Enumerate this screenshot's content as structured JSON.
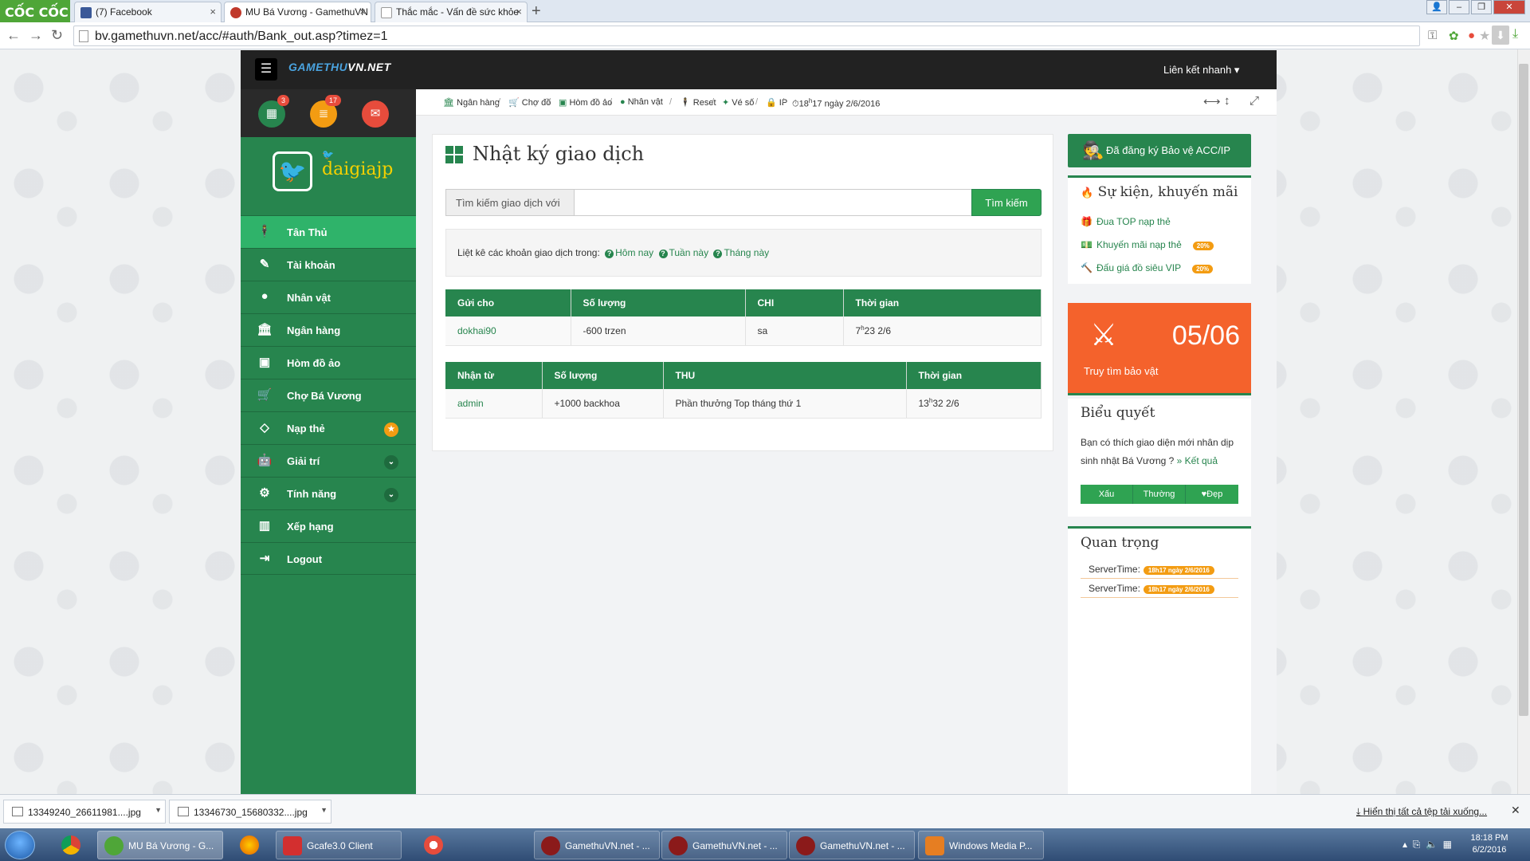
{
  "browser": {
    "brand": "CỐC CỐC",
    "tabs": [
      {
        "title": "(7) Facebook"
      },
      {
        "title": "MU Bá Vương - GamethuVN"
      },
      {
        "title": "Thắc mắc - Vấn đề sức khỏe"
      }
    ],
    "url": "bv.gamethuvn.net/acc/#auth/Bank_out.asp?timez=1"
  },
  "header": {
    "logo_prefix": "GAMETHU",
    "logo_suffix": "VN.NET",
    "quick_link": "Liên kết nhanh"
  },
  "top_icons": [
    {
      "icon": "calendar-icon",
      "badge": "3",
      "color": "#27854e"
    },
    {
      "icon": "list-icon",
      "badge": "17",
      "color": "#f39c12"
    },
    {
      "icon": "chat-icon",
      "badge": "",
      "color": "#e74c3c"
    }
  ],
  "profile": {
    "username": "daigiajp"
  },
  "sidebar": {
    "items": [
      {
        "label": "Tân Thủ",
        "icon": "person-icon",
        "active": true
      },
      {
        "label": "Tài khoản",
        "icon": "edit-icon"
      },
      {
        "label": "Nhân vật",
        "icon": "user-icon"
      },
      {
        "label": "Ngân hàng",
        "icon": "bank-icon"
      },
      {
        "label": "Hòm đồ ảo",
        "icon": "briefcase-icon"
      },
      {
        "label": "Chợ Bá Vương",
        "icon": "cart-icon"
      },
      {
        "label": "Nạp thẻ",
        "icon": "diamond-icon",
        "tag": "star"
      },
      {
        "label": "Giải trí",
        "icon": "android-icon",
        "tag": "chevron"
      },
      {
        "label": "Tính năng",
        "icon": "cogs-icon",
        "tag": "chevron"
      },
      {
        "label": "Xếp hạng",
        "icon": "chart-icon"
      },
      {
        "label": "Logout",
        "icon": "logout-icon"
      }
    ]
  },
  "breadcrumb": {
    "items": [
      "Ngân hàng",
      "Chợ đồ",
      "Hòm đồ ảo",
      "Nhân vật",
      "Reset",
      "Vé số",
      "IP"
    ],
    "time_hour": "18",
    "time_rest": "17 ngày 2/6/2016"
  },
  "main": {
    "title": "Nhật ký giao dịch",
    "search_addon": "Tìm kiếm giao dịch với",
    "search_value": "",
    "search_button": "Tìm kiếm",
    "filter_label": "Liệt kê các khoản giao dịch trong:",
    "filters": [
      "Hôm nay",
      "Tuần này",
      "Tháng này"
    ],
    "sent_table": {
      "headers": [
        "Gửi cho",
        "Số lượng",
        "CHI",
        "Thời gian"
      ],
      "rows": [
        {
          "to": "dokhai90",
          "amount": "-600  trzen",
          "note": "sa",
          "hour": "7",
          "time": "23 2/6"
        }
      ]
    },
    "received_table": {
      "headers": [
        "Nhận từ",
        "Số lượng",
        "THU",
        "Thời gian"
      ],
      "rows": [
        {
          "from": "admin",
          "amount": "+1000  backhoa",
          "note": "Phần thưởng Top tháng thứ 1",
          "hour": "13",
          "time": "32 2/6"
        }
      ]
    }
  },
  "right": {
    "register_button": "Đã đăng ký Bảo vệ ACC/IP",
    "events_title": "Sự kiện, khuyến mãi",
    "events": [
      {
        "label": "Đua TOP nạp thẻ",
        "icon": "gift-icon",
        "hot": ""
      },
      {
        "label": "Khuyến mãi nạp thẻ",
        "icon": "money-icon",
        "hot": "20%"
      },
      {
        "label": "Đấu giá đồ siêu VIP",
        "icon": "gavel-icon",
        "hot": "20%"
      }
    ],
    "promo_date": "05/06",
    "promo_label": "Truy tìm bảo vật",
    "poll_title": "Biểu quyết",
    "poll_text": "Bạn có thích giao diện mới nhân dịp sinh nhật Bá Vương ?",
    "poll_link": "» Kết quả",
    "poll_options": [
      "Xấu",
      "Thường",
      "Đẹp"
    ],
    "important_title": "Quan trọng",
    "server_rows": [
      {
        "label": "ServerTime:",
        "value": "18h17 ngày 2/6/2016"
      },
      {
        "label": "ServerTime:",
        "value": "18h17 ngày 2/6/2016"
      }
    ]
  },
  "downloads": {
    "items": [
      "13349240_26611981....jpg",
      "13346730_15680332....jpg"
    ],
    "show_all": "Hiển thị tất cả tệp tải xuống..."
  },
  "taskbar": {
    "tasks": [
      "MU Bá Vương - G...",
      "Gcafe3.0 Client",
      "GamethuVN.net - ...",
      "GamethuVN.net - ...",
      "GamethuVN.net - ...",
      "Windows Media P..."
    ],
    "time": "18:18 PM",
    "date": "6/2/2016"
  }
}
